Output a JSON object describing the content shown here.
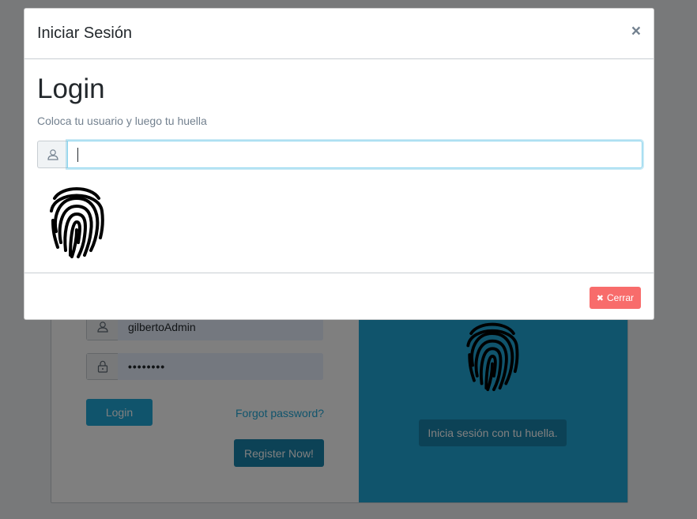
{
  "background": {
    "username_value": "gilbertoAdmin",
    "password_value": "••••••••",
    "login_label": "Login",
    "forgot_label": "Forgot password?",
    "register_label": "Register Now!",
    "fingerprint_button_label": "Inicia sesión con tu huella."
  },
  "modal": {
    "title": "Iniciar Sesión",
    "close_symbol": "×",
    "heading": "Login",
    "subtitle": "Coloca tu usuario y luego tu huella",
    "input_value": "",
    "close_button_label": "Cerrar",
    "close_button_icon": "✖"
  },
  "icons": {
    "user": "user-icon",
    "lock": "lock-icon",
    "fingerprint": "fingerprint-icon",
    "close": "close-icon"
  },
  "colors": {
    "primary": "#20a8d8",
    "primary_dark": "#1985ac",
    "danger": "#f86c6b"
  }
}
